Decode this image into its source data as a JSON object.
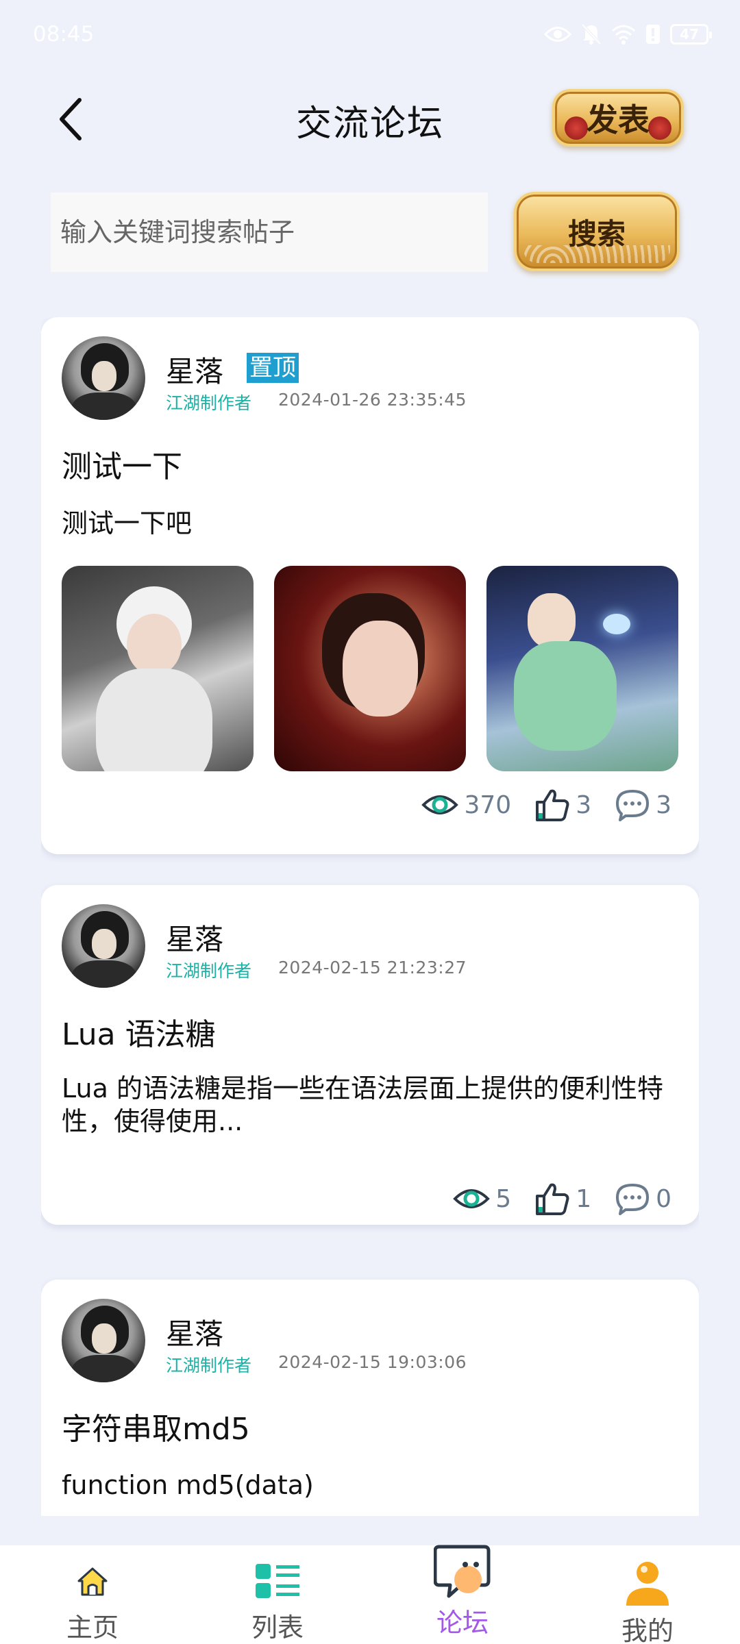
{
  "status_bar": {
    "time": "08:45",
    "battery": "47"
  },
  "header": {
    "title": "交流论坛",
    "publish_label": "发表"
  },
  "search": {
    "placeholder": "输入关键词搜索帖子",
    "button_label": "搜索"
  },
  "posts": [
    {
      "author": "星落",
      "badge": "置顶",
      "role": "江湖制作者",
      "time": "2024-01-26 23:35:45",
      "title": "测试一下",
      "body": "测试一下吧",
      "views": "370",
      "likes": "3",
      "comments": "3"
    },
    {
      "author": "星落",
      "role": "江湖制作者",
      "time": "2024-02-15 21:23:27",
      "title": "Lua 语法糖",
      "body": "Lua 的语法糖是指一些在语法层面上提供的便利性特性，使得使用...",
      "views": "5",
      "likes": "1",
      "comments": "0"
    },
    {
      "author": "星落",
      "role": "江湖制作者",
      "time": "2024-02-15 19:03:06",
      "title": "字符串取md5",
      "body": "function md5(data)"
    }
  ],
  "nav": [
    {
      "label": "主页",
      "icon": "home-icon"
    },
    {
      "label": "列表",
      "icon": "list-icon"
    },
    {
      "label": "论坛",
      "icon": "forum-icon"
    },
    {
      "label": "我的",
      "icon": "user-icon"
    }
  ],
  "colors": {
    "background": "#eef1fa",
    "accent": "#a259e6",
    "role": "#1bb2a6",
    "pin": "#1e9fd0",
    "stats": "#6b7b8e"
  }
}
